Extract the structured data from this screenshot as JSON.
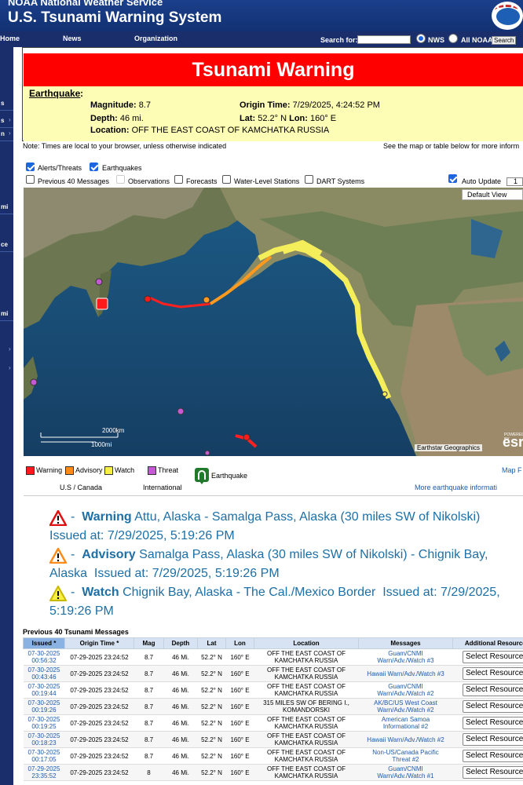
{
  "header": {
    "agency": "NOAA National Weather Service",
    "site_title": "U.S. Tsunami Warning System"
  },
  "nav": {
    "items": [
      "Home",
      "News",
      "Organization"
    ],
    "search_label": "Search for:",
    "search_value": "",
    "radio_nws": "NWS",
    "radio_all": "All NOAA",
    "search_button": "Search"
  },
  "sidebar": {
    "items": [
      "s",
      "s",
      "n",
      "mi",
      "ce",
      "mi"
    ]
  },
  "banner": {
    "title": "Tsunami Warning",
    "color": "#ff0000"
  },
  "earthquake": {
    "heading": "Earthquake",
    "magnitude_label": "Magnitude:",
    "magnitude": "8.7",
    "depth_label": "Depth:",
    "depth": "46 mi.",
    "origin_label": "Origin Time:",
    "origin_time": "7/29/2025, 4:24:52 PM",
    "lat_label": "Lat:",
    "lat": "52.2° N",
    "lon_label": "Lon:",
    "lon": "160° E",
    "location_label": "Location:",
    "location": "OFF THE EAST COAST OF KAMCHATKA RUSSIA"
  },
  "notes": {
    "left": "Note: Times are local to your browser, unless otherwise indicated",
    "right": "See the map or table below for more inform"
  },
  "layers": {
    "alerts_threats": "Alerts/Threats",
    "earthquakes": "Earthquakes",
    "previous_40": "Previous 40 Messages",
    "observations": "Observations",
    "forecasts": "Forecasts",
    "water_level": "Water-Level Stations",
    "dart": "DART Systems",
    "auto_update": "Auto Update",
    "auto_update_value": "1"
  },
  "map": {
    "default_view": "Default View",
    "scale_km": "2000km",
    "scale_mi": "1000mi",
    "attribution": "Earthstar Geographics",
    "powered_by": "POWERED BY",
    "esri": "esri"
  },
  "legend": {
    "warning": "Warning",
    "advisory": "Advisory",
    "watch": "Watch",
    "threat": "Threat",
    "earthquake": "Earthquake",
    "us_canada": "U.S / Canada",
    "international": "International",
    "map_link": "Map F",
    "more_link": "More earthquake informati",
    "colors": {
      "warning": "#ff1a1a",
      "advisory": "#ff8c1a",
      "watch": "#f7f043",
      "threat": "#c35ad1"
    }
  },
  "alerts": [
    {
      "level": "Warning",
      "text": "Attu, Alaska - Samalga Pass, Alaska (30 miles SW of Nikolski)",
      "issued": "Issued at: 7/29/2025, 5:19:26 PM"
    },
    {
      "level": "Advisory",
      "text": "Samalga Pass, Alaska (30 miles SW of Nikolski) - Chignik Bay, Alaska",
      "issued": "Issued at: 7/29/2025, 5:19:26 PM"
    },
    {
      "level": "Watch",
      "text": "Chignik Bay, Alaska - The Cal./Mexico Border",
      "issued": "Issued at: 7/29/2025, 5:19:26 PM"
    }
  ],
  "messages_table": {
    "title": "Previous 40 Tsunami Messages",
    "columns": [
      "Issued *",
      "Origin Time *",
      "Mag",
      "Depth",
      "Lat",
      "Lon",
      "Location",
      "Messages",
      "Additional Resources"
    ],
    "select_label": "Select Resource",
    "rows": [
      {
        "issued": [
          "07-30-2025",
          "00:56:32"
        ],
        "origin": "07-29-2025 23:24:52",
        "mag": "8.7",
        "depth": "46 Mi.",
        "lat": "52.2° N",
        "lon": "160° E",
        "location": [
          "OFF THE EAST COAST OF",
          "KAMCHATKA RUSSIA"
        ],
        "message": [
          "Guam/CNMI",
          "Warn/Adv./Watch #3"
        ]
      },
      {
        "issued": [
          "07-30-2025",
          "00:43:46"
        ],
        "origin": "07-29-2025 23:24:52",
        "mag": "8.7",
        "depth": "46 Mi.",
        "lat": "52.2° N",
        "lon": "160° E",
        "location": [
          "OFF THE EAST COAST OF",
          "KAMCHATKA RUSSIA"
        ],
        "message": [
          "Hawaii  Warn/Adv./Watch #3",
          ""
        ]
      },
      {
        "issued": [
          "07-30-2025",
          "00:19:44"
        ],
        "origin": "07-29-2025 23:24:52",
        "mag": "8.7",
        "depth": "46 Mi.",
        "lat": "52.2° N",
        "lon": "160° E",
        "location": [
          "OFF THE EAST COAST OF",
          "KAMCHATKA RUSSIA"
        ],
        "message": [
          "Guam/CNMI",
          "Warn/Adv./Watch #2"
        ]
      },
      {
        "issued": [
          "07-30-2025",
          "00:19:26"
        ],
        "origin": "07-29-2025 23:24:52",
        "mag": "8.7",
        "depth": "46 Mi.",
        "lat": "52.2° N",
        "lon": "160° E",
        "location": [
          "315 MILES SW OF BERING I.,",
          "KOMANDORSKI"
        ],
        "message": [
          "AK/BC/US West Coast",
          "Warn/Adv./Watch #2"
        ]
      },
      {
        "issued": [
          "07-30-2025",
          "00:19:25"
        ],
        "origin": "07-29-2025 23:24:52",
        "mag": "8.7",
        "depth": "46 Mi.",
        "lat": "52.2° N",
        "lon": "160° E",
        "location": [
          "OFF THE EAST COAST OF",
          "KAMCHATKA RUSSIA"
        ],
        "message": [
          "American Samoa",
          "Informational #2"
        ]
      },
      {
        "issued": [
          "07-30-2025",
          "00:18:23"
        ],
        "origin": "07-29-2025 23:24:52",
        "mag": "8.7",
        "depth": "46 Mi.",
        "lat": "52.2° N",
        "lon": "160° E",
        "location": [
          "OFF THE EAST COAST OF",
          "KAMCHATKA RUSSIA"
        ],
        "message": [
          "Hawaii  Warn/Adv./Watch #2",
          ""
        ]
      },
      {
        "issued": [
          "07-30-2025",
          "00:17:05"
        ],
        "origin": "07-29-2025 23:24:52",
        "mag": "8.7",
        "depth": "46 Mi.",
        "lat": "52.2° N",
        "lon": "160° E",
        "location": [
          "OFF THE EAST COAST OF",
          "KAMCHATKA RUSSIA"
        ],
        "message": [
          "Non-US/Canada Pacific",
          "Threat #2"
        ]
      },
      {
        "issued": [
          "07-29-2025",
          "23:35:52"
        ],
        "origin": "07-29-2025 23:24:52",
        "mag": "8",
        "depth": "46 Mi.",
        "lat": "52.2° N",
        "lon": "160° E",
        "location": [
          "OFF THE EAST COAST OF",
          "KAMCHATKA RUSSIA"
        ],
        "message": [
          "Guam/CNMI",
          "Warn/Adv./Watch #1"
        ]
      }
    ]
  }
}
